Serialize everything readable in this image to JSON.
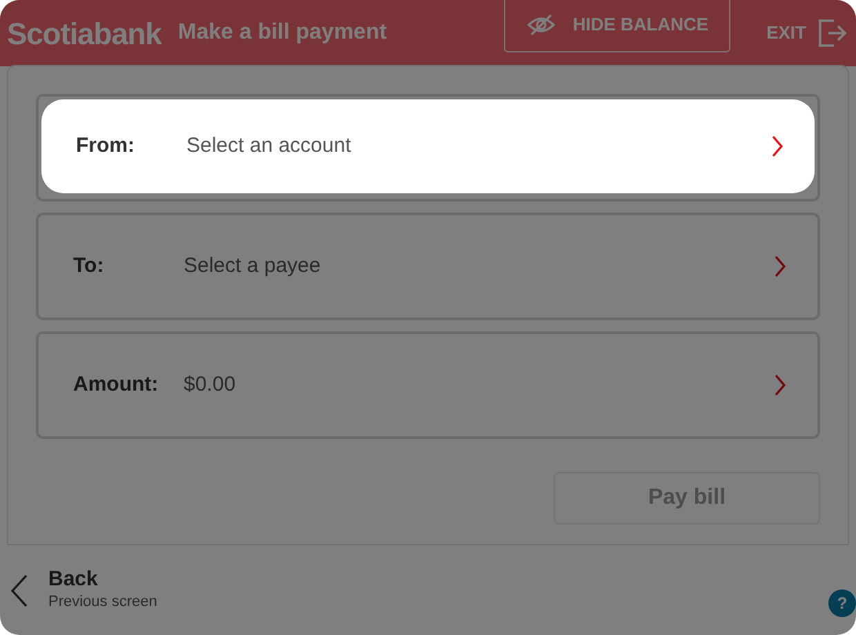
{
  "header": {
    "logo": "Scotiabank",
    "title": "Make a bill payment",
    "hide_balance": "HIDE BALANCE",
    "exit": "EXIT"
  },
  "overlay": {
    "shown": true
  },
  "fields": [
    {
      "label": "From:",
      "value": "Select an account",
      "highlighted": true
    },
    {
      "label": "To:",
      "value": "Select a payee",
      "highlighted": false
    },
    {
      "label": "Amount:",
      "value": "$0.00",
      "highlighted": false
    }
  ],
  "pay_button": {
    "label": "Pay bill",
    "disabled": true
  },
  "back": {
    "label": "Back",
    "sublabel": "Previous screen"
  },
  "help": "?"
}
